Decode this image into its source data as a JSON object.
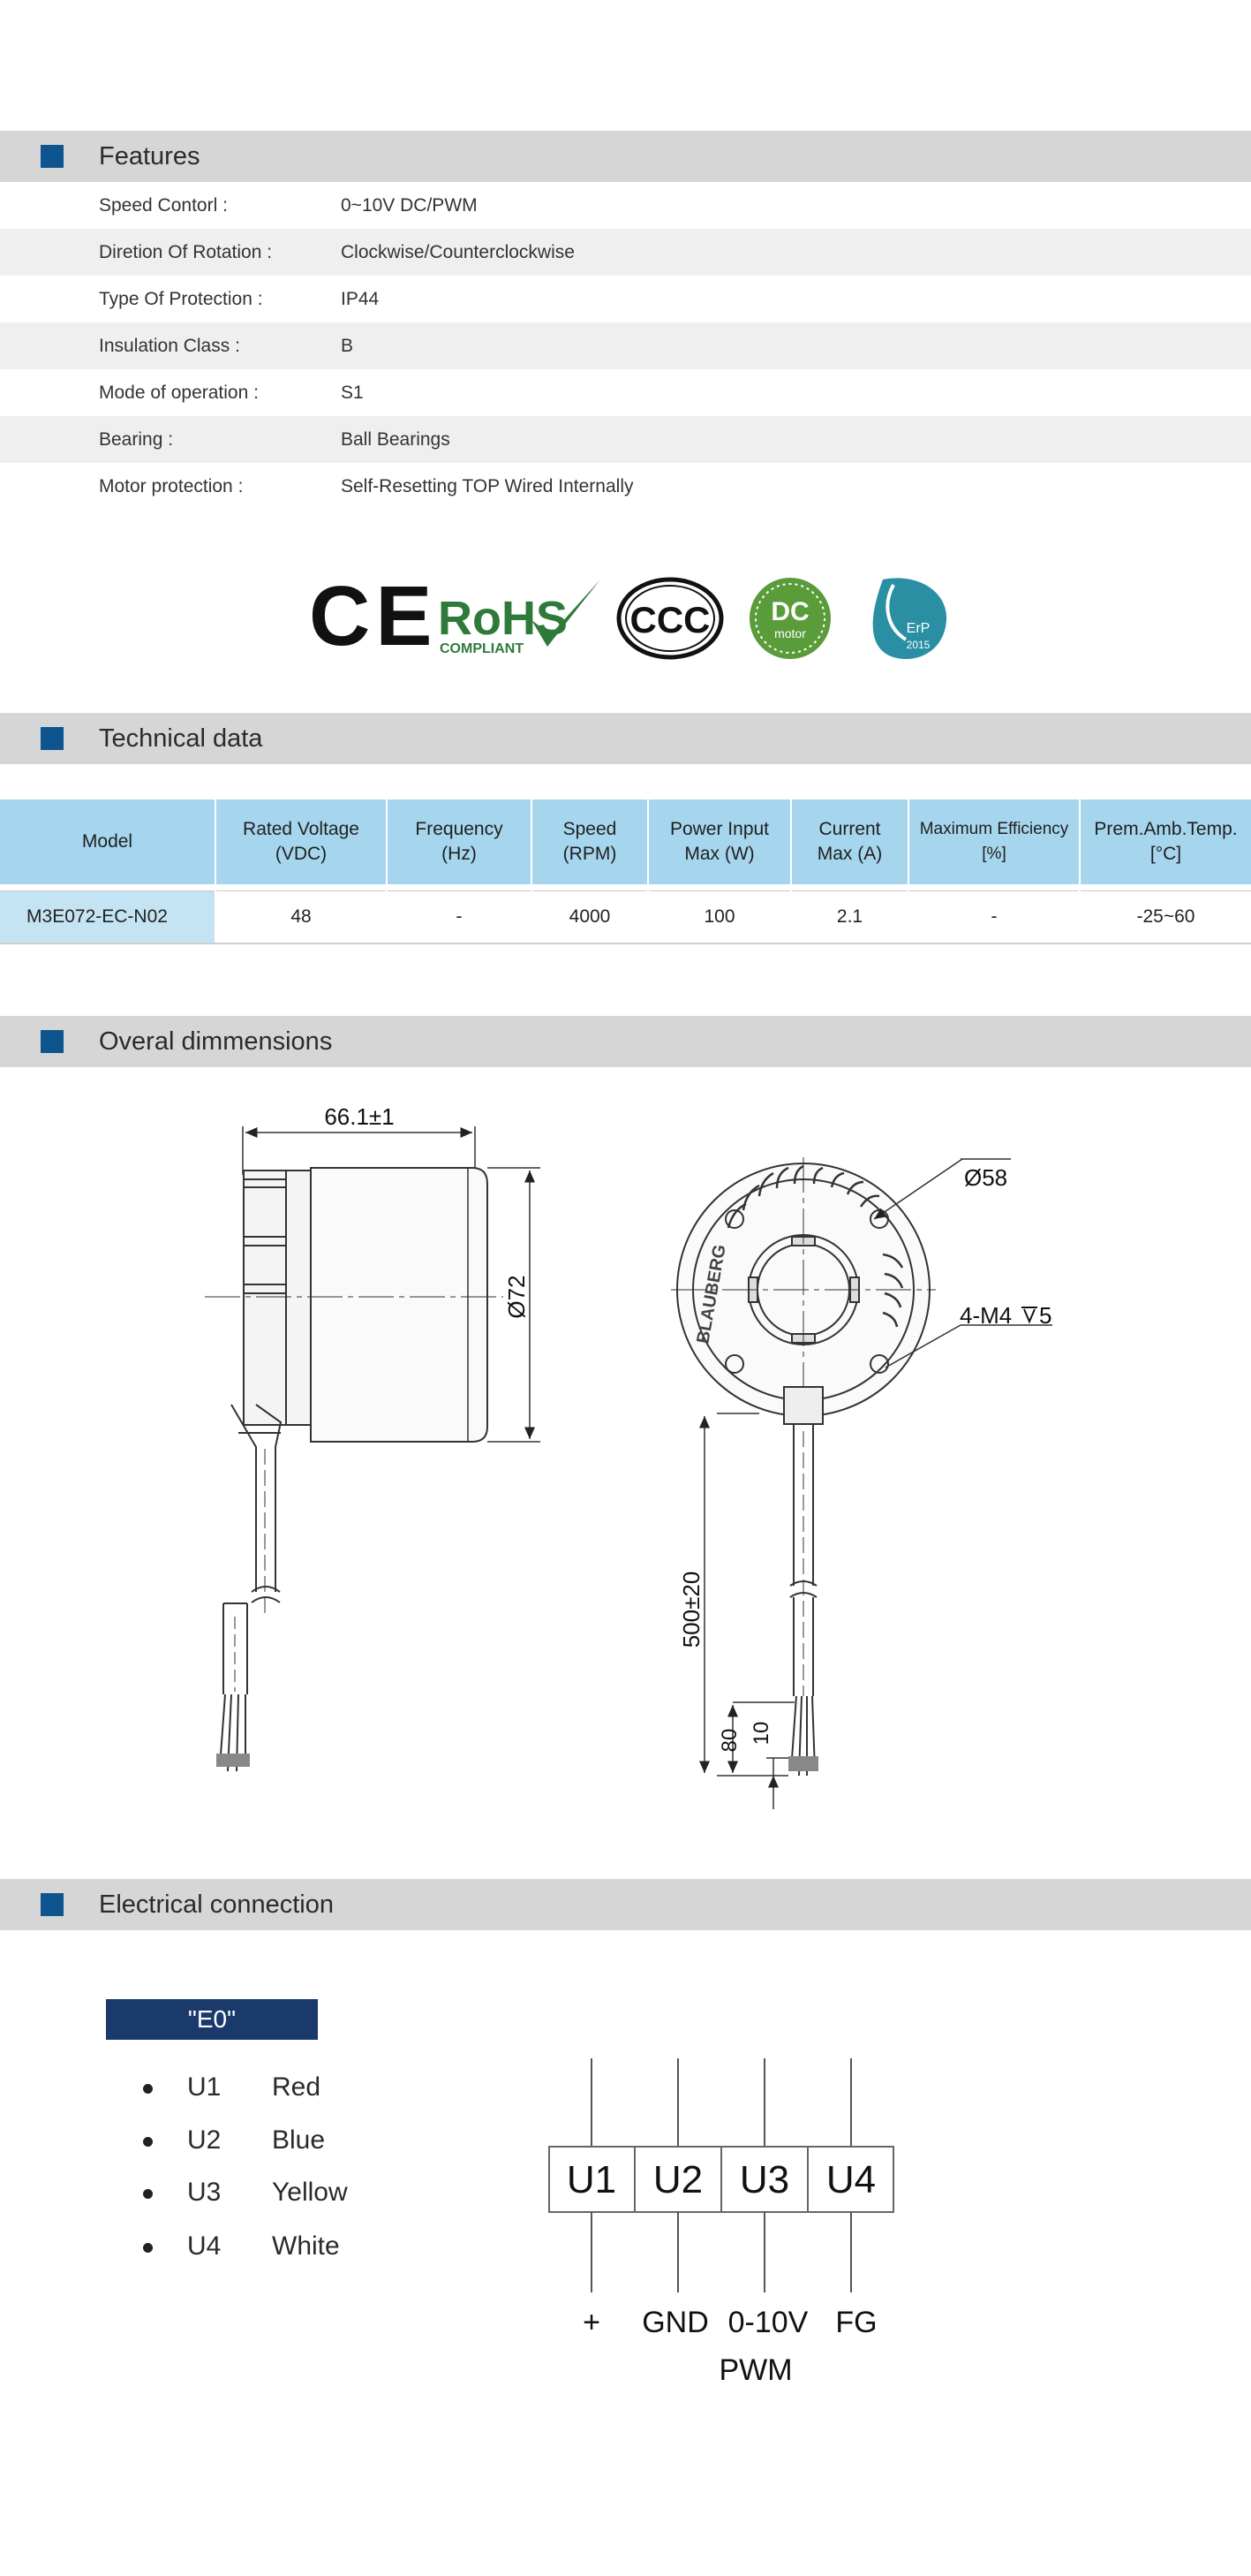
{
  "features": {
    "title": "Features",
    "rows": [
      {
        "label": "Speed Contorl :",
        "value": "0~10V DC/PWM"
      },
      {
        "label": "Diretion  Of  Rotation   :",
        "value": "Clockwise/Counterclockwise"
      },
      {
        "label": "Type Of Protection :",
        "value": "IP44"
      },
      {
        "label": "Insulation   Class  :",
        "value": "B"
      },
      {
        "label": "Mode of operation :",
        "value": "S1"
      },
      {
        "label": "Bearing  :",
        "value": "Ball Bearings"
      },
      {
        "label": "Motor protection  :",
        "value": "Self-Resetting TOP Wired Internally"
      }
    ]
  },
  "certifications": {
    "ce": "CE",
    "rohs_main": "RoHS",
    "rohs_sub": "COMPLIANT",
    "ccc": "CCC",
    "dc_main": "DC",
    "dc_sub": "motor",
    "erp_main": "ErP",
    "erp_sub": "2015"
  },
  "technical": {
    "title": "Technical data",
    "headers": [
      [
        "Model"
      ],
      [
        "Rated Voltage",
        "(VDC)"
      ],
      [
        "Frequency",
        "(Hz)"
      ],
      [
        "Speed",
        "(RPM)"
      ],
      [
        "Power Input",
        "Max (W)"
      ],
      [
        "Current",
        "Max (A)"
      ],
      [
        "Maximum Efficiency",
        "[%]"
      ],
      [
        "Prem.Amb.Temp.",
        "[°C]"
      ]
    ],
    "row": [
      "M3E072-EC-N02",
      "48",
      "-",
      "4000",
      "100",
      "2.1",
      "-",
      "-25~60"
    ]
  },
  "dimensions": {
    "title": "Overal dimmensions",
    "length": "66.1±1",
    "diameter_body": "Ø72",
    "diameter_mount": "Ø58",
    "mount_thread": "4-M4",
    "mount_depth": "5",
    "cable_length": "500±20",
    "strip_length": "80",
    "tip_length": "10",
    "brand_mark": "BLAUBERG"
  },
  "electrical": {
    "title": "Electrical  connection",
    "label": "\"E0\"",
    "wires": [
      {
        "code": "U1",
        "color": "Red"
      },
      {
        "code": "U2",
        "color": "Blue"
      },
      {
        "code": "U3",
        "color": "Yellow"
      },
      {
        "code": "U4",
        "color": "White"
      }
    ],
    "terminals": [
      "U1",
      "U2",
      "U3",
      "U4"
    ],
    "signals": [
      "+",
      "GND",
      "0-10V",
      "FG"
    ],
    "signal_sub": "PWM"
  }
}
